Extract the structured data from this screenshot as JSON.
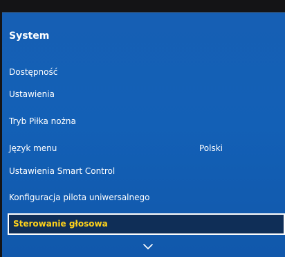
{
  "menu": {
    "title": "System",
    "items": [
      {
        "label": "Dostępność",
        "value": ""
      },
      {
        "label": "Ustawienia",
        "value": ""
      },
      {
        "label": "Tryb Piłka nożna",
        "value": ""
      },
      {
        "label": "Język menu",
        "value": "Polski"
      },
      {
        "label": "Ustawienia Smart Control",
        "value": ""
      },
      {
        "label": "Konfiguracja pilota uniwersalnego",
        "value": ""
      },
      {
        "label": "Sterowanie głosowa",
        "value": "",
        "selected": true
      }
    ],
    "scroll_icon": "chevron-down-icon"
  },
  "colors": {
    "panel_blue": "#1360b6",
    "selected_bg": "#0f2e57",
    "selected_text": "#ffd21a",
    "background": "#141416"
  }
}
